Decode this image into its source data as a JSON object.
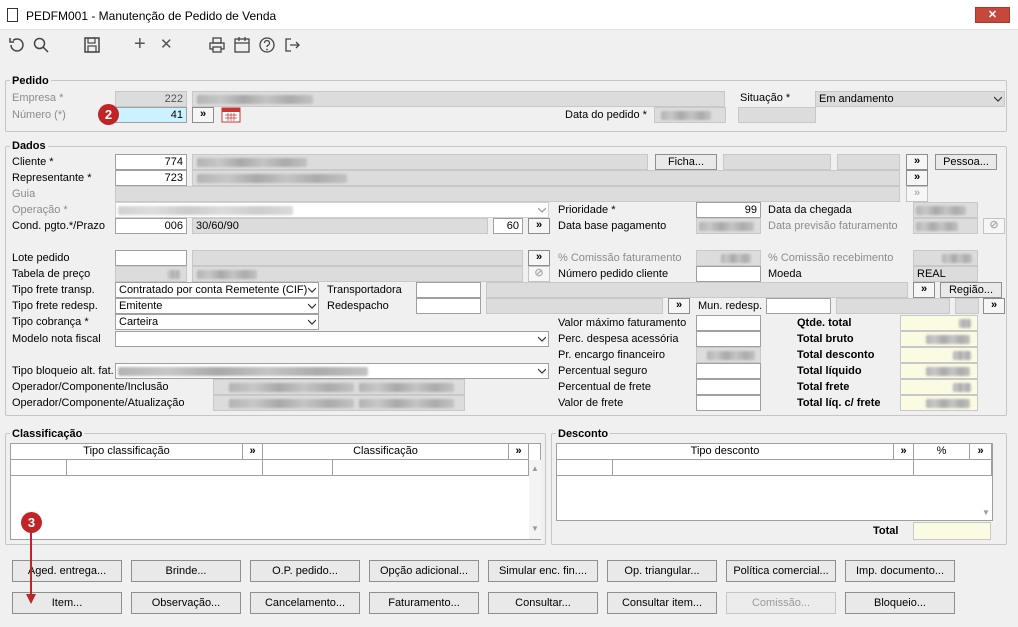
{
  "window": {
    "title": "PEDFM001 - Manutenção de Pedido de Venda",
    "close": "✕"
  },
  "toolbar": {
    "add": "+",
    "remove": "✕"
  },
  "pedido": {
    "section": "Pedido",
    "empresa_label": "Empresa *",
    "empresa_value": "222",
    "numero_label": "Número (*)",
    "numero_value": "41",
    "data_label": "Data do pedido *",
    "situacao_label": "Situação *",
    "situacao_value": "Em andamento",
    "nav": "»"
  },
  "dados": {
    "section": "Dados",
    "cliente_label": "Cliente *",
    "cliente_value": "774",
    "ficha": "Ficha...",
    "pessoa": "Pessoa...",
    "representante_label": "Representante *",
    "representante_value": "723",
    "guia_label": "Guia",
    "operacao_label": "Operação *",
    "condpgto_label": "Cond. pgto.*/Prazo",
    "condpgto_value": "006",
    "condpgto_desc": "30/60/90",
    "prazo_value": "60",
    "prioridade_label": "Prioridade *",
    "prioridade_value": "99",
    "database_label": "Data base pagamento",
    "datachegada_label": "Data da chegada",
    "dataprev_label": "Data previsão faturamento",
    "lote_label": "Lote pedido",
    "tabela_label": "Tabela de preço",
    "comfat_label": "% Comissão faturamento",
    "comrec_label": "% Comissão recebimento",
    "numcliente_label": "Número pedido cliente",
    "moeda_label": "Moeda",
    "moeda_value": "REAL",
    "fretetransp_label": "Tipo frete transp.",
    "fretetransp_value": "Contratado por conta Remetente (CIF)",
    "transportadora_label": "Transportadora",
    "regiao": "Região...",
    "freteredesp_label": "Tipo frete redesp.",
    "freteredesp_value": "Emitente",
    "redespacho_label": "Redespacho",
    "munredesp_label": "Mun. redesp.",
    "cobranca_label": "Tipo cobrança *",
    "cobranca_value": "Carteira",
    "modelo_label": "Modelo nota fiscal",
    "bloqueio_label": "Tipo bloqueio alt. fat.",
    "opinc_label": "Operador/Componente/Inclusão",
    "opatu_label": "Operador/Componente/Atualização",
    "valmax_label": "Valor máximo faturamento",
    "perc_desp_label": "Perc. despesa acessória",
    "encargo_label": "Pr. encargo financeiro",
    "seguro_label": "Percentual seguro",
    "percfrete_label": "Percentual de frete",
    "valfrete_label": "Valor de frete",
    "qtde_label": "Qtde. total",
    "bruto_label": "Total bruto",
    "desconto_label": "Total desconto",
    "liquido_label": "Total líquido",
    "frete_label": "Total frete",
    "liqfrete_label": "Total líq. c/ frete"
  },
  "classificacao": {
    "section": "Classificação",
    "col1": "Tipo classificação",
    "col2": "Classificação"
  },
  "desconto": {
    "section": "Desconto",
    "col1": "Tipo desconto",
    "col2": "%",
    "total_label": "Total"
  },
  "buttons_row1": [
    "Aged. entrega...",
    "Brinde...",
    "O.P. pedido...",
    "Opção adicional...",
    "Simular enc. fin....",
    "Op. triangular...",
    "Política comercial...",
    "Imp. documento..."
  ],
  "buttons_row2": [
    "Item...",
    "Observação...",
    "Cancelamento...",
    "Faturamento...",
    "Consultar...",
    "Consultar item...",
    "Comissão...",
    "Bloqueio..."
  ],
  "badges": {
    "b2": "2",
    "b3": "3"
  },
  "colors": {
    "badge": "#c02427",
    "highlight": "#ccf2ff",
    "yellow": "#fbfbe3"
  }
}
